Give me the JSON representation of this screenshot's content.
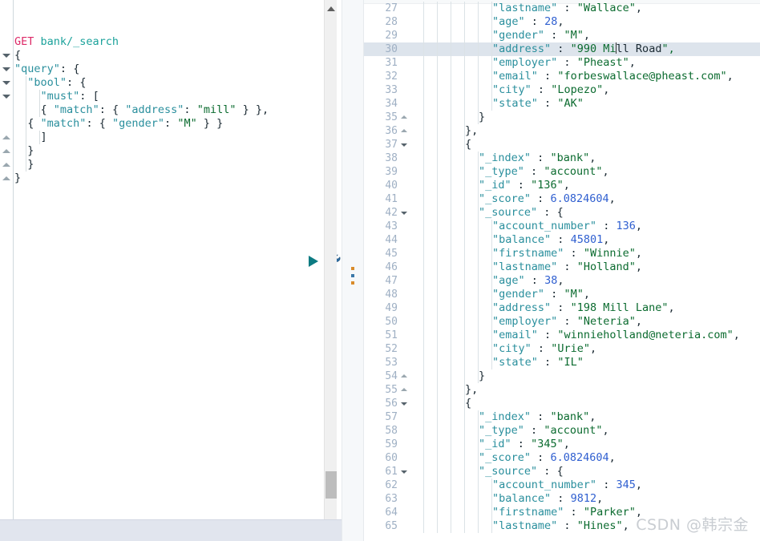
{
  "colors": {
    "method": "#dd2a68",
    "url": "#1ba29b",
    "key": "#2a8f9d",
    "string": "#0b6b2f",
    "number": "#2f5fd0",
    "line_number": "#9fb0c4",
    "highlight_row": "#dde4ec",
    "splitter_bg": "#f6f8fa",
    "scrollbar_thumb": "#bdbdbd"
  },
  "editor": {
    "name": "request-editor",
    "request_method": "GET",
    "request_path": "bank/_search",
    "lines": [
      {
        "n": 1,
        "indent": 0,
        "text": "",
        "method": "GET",
        "path": "bank/_search",
        "type": "request"
      },
      {
        "n": 2,
        "indent": 0,
        "text": "{",
        "type": "punc",
        "fold": "down"
      },
      {
        "n": 3,
        "indent": 0,
        "text": "\"query\": {",
        "type": "kv",
        "fold": "down"
      },
      {
        "n": 4,
        "indent": 1,
        "text": "\"bool\": {",
        "type": "kv",
        "fold": "down"
      },
      {
        "n": 5,
        "indent": 2,
        "text": "\"must\": [",
        "type": "kv",
        "fold": "down"
      },
      {
        "n": 6,
        "indent": 2,
        "text": "{ \"match\": { \"address\": \"mill\" } },",
        "type": "kv"
      },
      {
        "n": 7,
        "indent": 1,
        "text": "{ \"match\": { \"gender\": \"M\" } }",
        "type": "kv"
      },
      {
        "n": 8,
        "indent": 2,
        "text": "]",
        "type": "punc",
        "fold": "up"
      },
      {
        "n": 9,
        "indent": 1,
        "text": "}",
        "type": "punc",
        "fold": "up"
      },
      {
        "n": 10,
        "indent": 1,
        "text": "}",
        "type": "punc",
        "fold": "up"
      },
      {
        "n": 11,
        "indent": 0,
        "text": "}",
        "type": "punc",
        "fold": "up"
      }
    ],
    "actions": {
      "play_label": "send-request",
      "wrench_label": "request-options"
    },
    "scrollbar": {
      "name": "editor-vertical-scrollbar"
    }
  },
  "splitter": {
    "name": "pane-splitter"
  },
  "output": {
    "name": "response-viewer",
    "highlighted_line": 30,
    "lines": [
      {
        "n": 27,
        "indent": 6,
        "text": "\"lastname\" : \"Wallace\","
      },
      {
        "n": 28,
        "indent": 6,
        "text": "\"age\" : 28,"
      },
      {
        "n": 29,
        "indent": 6,
        "text": "\"gender\" : \"M\","
      },
      {
        "n": 30,
        "indent": 6,
        "text": "\"address\" : \"990 Mill Road\",",
        "caret_after": "\"address\" : \"990 Mi"
      },
      {
        "n": 31,
        "indent": 6,
        "text": "\"employer\" : \"Pheast\","
      },
      {
        "n": 32,
        "indent": 6,
        "text": "\"email\" : \"forbeswallace@pheast.com\","
      },
      {
        "n": 33,
        "indent": 6,
        "text": "\"city\" : \"Lopezo\","
      },
      {
        "n": 34,
        "indent": 6,
        "text": "\"state\" : \"AK\""
      },
      {
        "n": 35,
        "indent": 5,
        "text": "}",
        "fold": "up"
      },
      {
        "n": 36,
        "indent": 4,
        "text": "},",
        "fold": "up"
      },
      {
        "n": 37,
        "indent": 4,
        "text": "{",
        "fold": "down"
      },
      {
        "n": 38,
        "indent": 5,
        "text": "\"_index\" : \"bank\","
      },
      {
        "n": 39,
        "indent": 5,
        "text": "\"_type\" : \"account\","
      },
      {
        "n": 40,
        "indent": 5,
        "text": "\"_id\" : \"136\","
      },
      {
        "n": 41,
        "indent": 5,
        "text": "\"_score\" : 6.0824604,"
      },
      {
        "n": 42,
        "indent": 5,
        "text": "\"_source\" : {",
        "fold": "down"
      },
      {
        "n": 43,
        "indent": 6,
        "text": "\"account_number\" : 136,"
      },
      {
        "n": 44,
        "indent": 6,
        "text": "\"balance\" : 45801,"
      },
      {
        "n": 45,
        "indent": 6,
        "text": "\"firstname\" : \"Winnie\","
      },
      {
        "n": 46,
        "indent": 6,
        "text": "\"lastname\" : \"Holland\","
      },
      {
        "n": 47,
        "indent": 6,
        "text": "\"age\" : 38,"
      },
      {
        "n": 48,
        "indent": 6,
        "text": "\"gender\" : \"M\","
      },
      {
        "n": 49,
        "indent": 6,
        "text": "\"address\" : \"198 Mill Lane\","
      },
      {
        "n": 50,
        "indent": 6,
        "text": "\"employer\" : \"Neteria\","
      },
      {
        "n": 51,
        "indent": 6,
        "text": "\"email\" : \"winnieholland@neteria.com\","
      },
      {
        "n": 52,
        "indent": 6,
        "text": "\"city\" : \"Urie\","
      },
      {
        "n": 53,
        "indent": 6,
        "text": "\"state\" : \"IL\""
      },
      {
        "n": 54,
        "indent": 5,
        "text": "}",
        "fold": "up"
      },
      {
        "n": 55,
        "indent": 4,
        "text": "},",
        "fold": "up"
      },
      {
        "n": 56,
        "indent": 4,
        "text": "{",
        "fold": "down"
      },
      {
        "n": 57,
        "indent": 5,
        "text": "\"_index\" : \"bank\","
      },
      {
        "n": 58,
        "indent": 5,
        "text": "\"_type\" : \"account\","
      },
      {
        "n": 59,
        "indent": 5,
        "text": "\"_id\" : \"345\","
      },
      {
        "n": 60,
        "indent": 5,
        "text": "\"_score\" : 6.0824604,"
      },
      {
        "n": 61,
        "indent": 5,
        "text": "\"_source\" : {",
        "fold": "down"
      },
      {
        "n": 62,
        "indent": 6,
        "text": "\"account_number\" : 345,"
      },
      {
        "n": 63,
        "indent": 6,
        "text": "\"balance\" : 9812,"
      },
      {
        "n": 64,
        "indent": 6,
        "text": "\"firstname\" : \"Parker\","
      },
      {
        "n": 65,
        "indent": 6,
        "text": "\"lastname\" : \"Hines\","
      }
    ]
  },
  "watermark": {
    "text": "CSDN @韩宗金"
  }
}
